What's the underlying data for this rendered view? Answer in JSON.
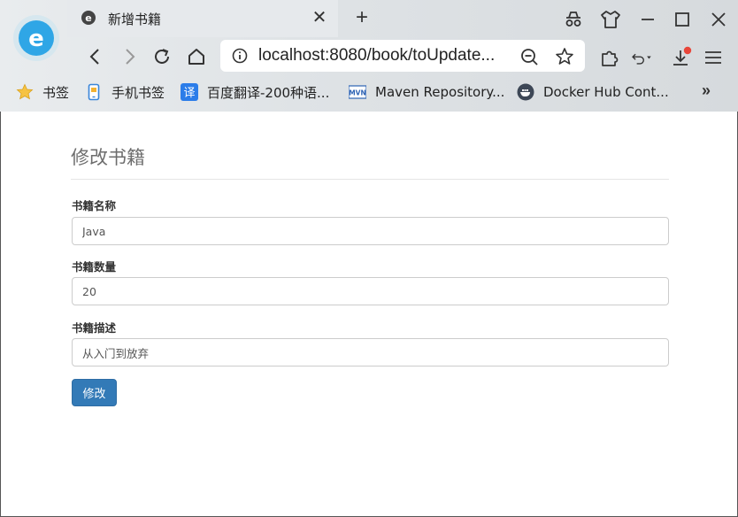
{
  "browser": {
    "tab_title": "新增书籍",
    "new_tab_symbol": "+",
    "close_symbol": "✕",
    "url": "localhost:8080/book/toUpdate...",
    "bookmarks": [
      {
        "label": "书签",
        "icon": "star-icon"
      },
      {
        "label": "手机书签",
        "icon": "phone-icon"
      },
      {
        "label": "百度翻译-200种语...",
        "icon": "translate-icon"
      },
      {
        "label": "Maven Repository...",
        "icon": "maven-icon"
      },
      {
        "label": "Docker Hub Cont...",
        "icon": "docker-icon"
      }
    ],
    "bookmarks_more": "»",
    "translate_glyph": "译",
    "maven_glyph": "MVN"
  },
  "page": {
    "title": "修改书籍",
    "name_label": "书籍名称",
    "name_value": "Java",
    "count_label": "书籍数量",
    "count_value": "20",
    "desc_label": "书籍描述",
    "desc_value": "从入门到放弃",
    "submit_label": "修改"
  },
  "colors": {
    "primary_button": "#337ab7",
    "download_badge": "#e8463a"
  }
}
